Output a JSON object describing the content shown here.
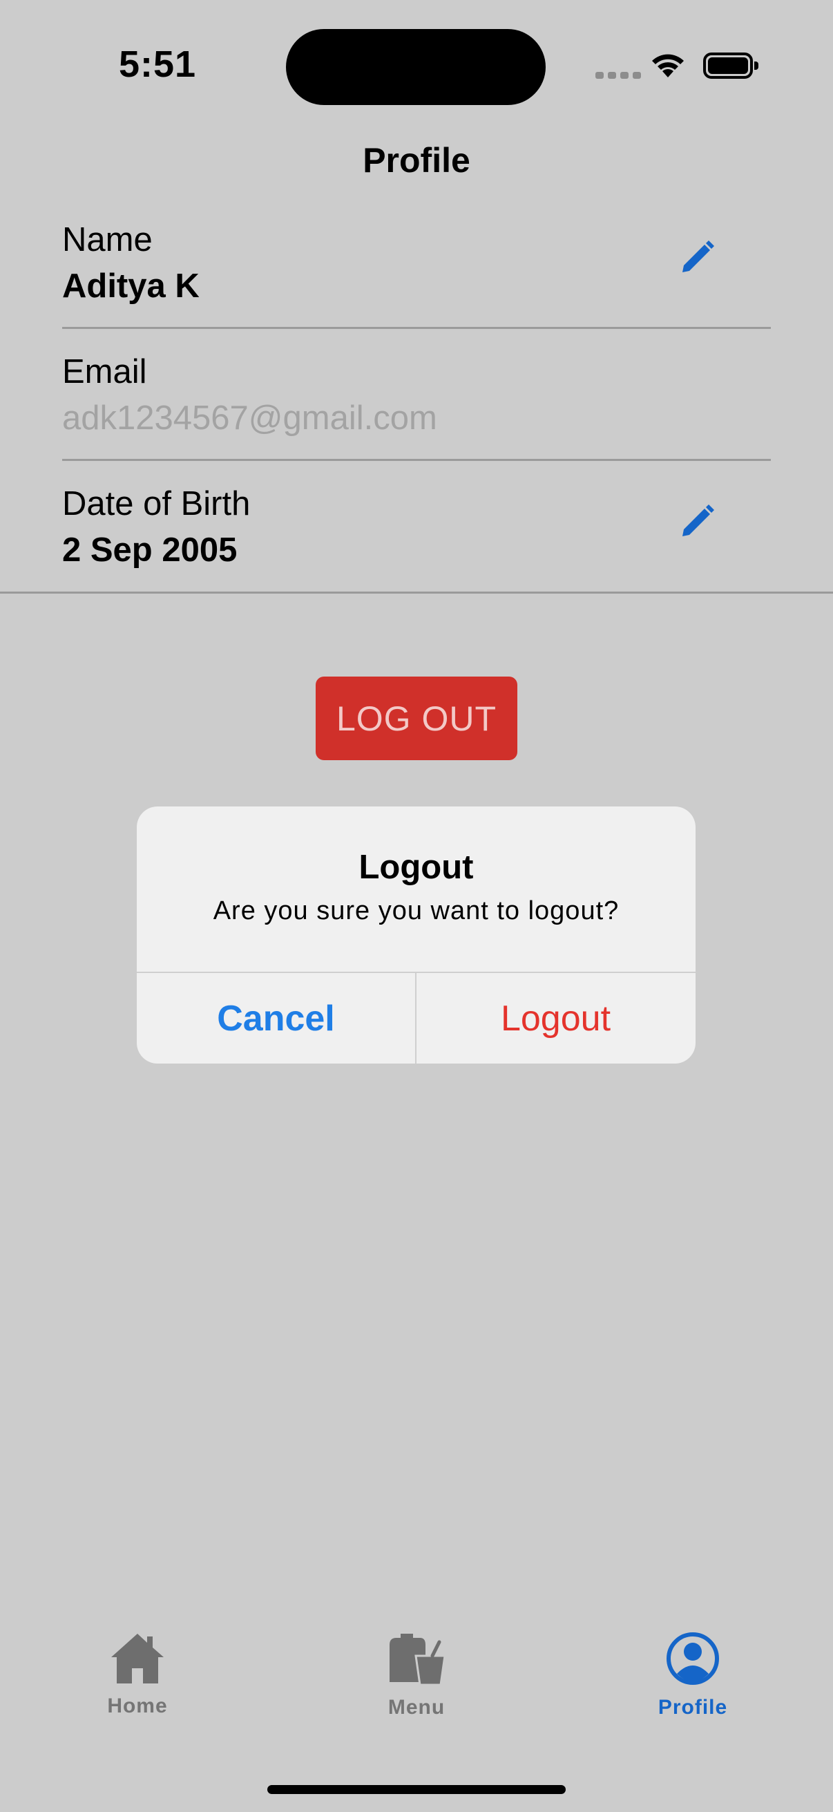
{
  "status_bar": {
    "time": "5:51"
  },
  "header": {
    "title": "Profile"
  },
  "profile": {
    "name": {
      "label": "Name",
      "value": "Aditya K"
    },
    "email": {
      "label": "Email",
      "value": "adk1234567@gmail.com"
    },
    "dob": {
      "label": "Date of Birth",
      "value": "2 Sep 2005"
    }
  },
  "logout_button": {
    "label": "LOG OUT"
  },
  "alert": {
    "title": "Logout",
    "message": "Are you sure you want to logout?",
    "cancel_label": "Cancel",
    "confirm_label": "Logout"
  },
  "tab_bar": {
    "items": [
      {
        "label": "Home",
        "icon": "home-icon"
      },
      {
        "label": "Menu",
        "icon": "menu-bag-icon"
      },
      {
        "label": "Profile",
        "icon": "profile-icon",
        "active": true
      }
    ]
  },
  "colors": {
    "background": "#cccccc",
    "accent": "#1565c8",
    "destructive": "#d0302a",
    "alert_cancel": "#1f7ee6",
    "alert_destructive": "#e4332c"
  }
}
